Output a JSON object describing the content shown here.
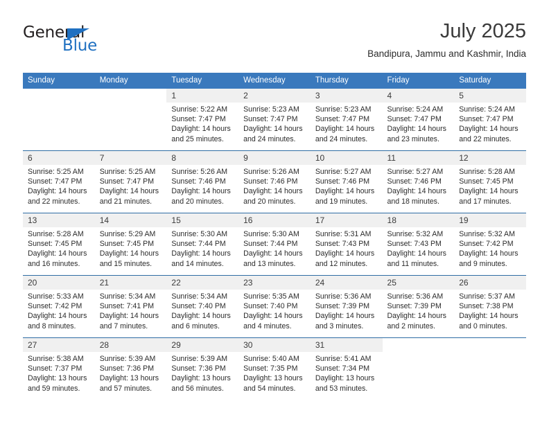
{
  "brand": {
    "name_part1": "General",
    "name_part2": "Blue"
  },
  "header": {
    "title": "July 2025",
    "subtitle": "Bandipura, Jammu and Kashmir, India"
  },
  "colors": {
    "header_blue": "#3a79bd",
    "row_rule_blue": "#2e6da4",
    "daynum_band": "#f0f0f0",
    "brand_blue": "#1f70c1"
  },
  "weekday_headers": [
    "Sunday",
    "Monday",
    "Tuesday",
    "Wednesday",
    "Thursday",
    "Friday",
    "Saturday"
  ],
  "weeks": [
    [
      {
        "day": "",
        "blank": true,
        "shaded": false,
        "sunrise": "",
        "sunset": "",
        "daylight": ""
      },
      {
        "day": "",
        "blank": true,
        "shaded": false,
        "sunrise": "",
        "sunset": "",
        "daylight": ""
      },
      {
        "day": "1",
        "blank": false,
        "shaded": true,
        "sunrise": "Sunrise: 5:22 AM",
        "sunset": "Sunset: 7:47 PM",
        "daylight": "Daylight: 14 hours and 25 minutes."
      },
      {
        "day": "2",
        "blank": false,
        "shaded": true,
        "sunrise": "Sunrise: 5:23 AM",
        "sunset": "Sunset: 7:47 PM",
        "daylight": "Daylight: 14 hours and 24 minutes."
      },
      {
        "day": "3",
        "blank": false,
        "shaded": true,
        "sunrise": "Sunrise: 5:23 AM",
        "sunset": "Sunset: 7:47 PM",
        "daylight": "Daylight: 14 hours and 24 minutes."
      },
      {
        "day": "4",
        "blank": false,
        "shaded": true,
        "sunrise": "Sunrise: 5:24 AM",
        "sunset": "Sunset: 7:47 PM",
        "daylight": "Daylight: 14 hours and 23 minutes."
      },
      {
        "day": "5",
        "blank": false,
        "shaded": true,
        "sunrise": "Sunrise: 5:24 AM",
        "sunset": "Sunset: 7:47 PM",
        "daylight": "Daylight: 14 hours and 22 minutes."
      }
    ],
    [
      {
        "day": "6",
        "blank": false,
        "shaded": true,
        "sunrise": "Sunrise: 5:25 AM",
        "sunset": "Sunset: 7:47 PM",
        "daylight": "Daylight: 14 hours and 22 minutes."
      },
      {
        "day": "7",
        "blank": false,
        "shaded": true,
        "sunrise": "Sunrise: 5:25 AM",
        "sunset": "Sunset: 7:47 PM",
        "daylight": "Daylight: 14 hours and 21 minutes."
      },
      {
        "day": "8",
        "blank": false,
        "shaded": true,
        "sunrise": "Sunrise: 5:26 AM",
        "sunset": "Sunset: 7:46 PM",
        "daylight": "Daylight: 14 hours and 20 minutes."
      },
      {
        "day": "9",
        "blank": false,
        "shaded": true,
        "sunrise": "Sunrise: 5:26 AM",
        "sunset": "Sunset: 7:46 PM",
        "daylight": "Daylight: 14 hours and 20 minutes."
      },
      {
        "day": "10",
        "blank": false,
        "shaded": true,
        "sunrise": "Sunrise: 5:27 AM",
        "sunset": "Sunset: 7:46 PM",
        "daylight": "Daylight: 14 hours and 19 minutes."
      },
      {
        "day": "11",
        "blank": false,
        "shaded": true,
        "sunrise": "Sunrise: 5:27 AM",
        "sunset": "Sunset: 7:46 PM",
        "daylight": "Daylight: 14 hours and 18 minutes."
      },
      {
        "day": "12",
        "blank": false,
        "shaded": true,
        "sunrise": "Sunrise: 5:28 AM",
        "sunset": "Sunset: 7:45 PM",
        "daylight": "Daylight: 14 hours and 17 minutes."
      }
    ],
    [
      {
        "day": "13",
        "blank": false,
        "shaded": true,
        "sunrise": "Sunrise: 5:28 AM",
        "sunset": "Sunset: 7:45 PM",
        "daylight": "Daylight: 14 hours and 16 minutes."
      },
      {
        "day": "14",
        "blank": false,
        "shaded": true,
        "sunrise": "Sunrise: 5:29 AM",
        "sunset": "Sunset: 7:45 PM",
        "daylight": "Daylight: 14 hours and 15 minutes."
      },
      {
        "day": "15",
        "blank": false,
        "shaded": true,
        "sunrise": "Sunrise: 5:30 AM",
        "sunset": "Sunset: 7:44 PM",
        "daylight": "Daylight: 14 hours and 14 minutes."
      },
      {
        "day": "16",
        "blank": false,
        "shaded": true,
        "sunrise": "Sunrise: 5:30 AM",
        "sunset": "Sunset: 7:44 PM",
        "daylight": "Daylight: 14 hours and 13 minutes."
      },
      {
        "day": "17",
        "blank": false,
        "shaded": true,
        "sunrise": "Sunrise: 5:31 AM",
        "sunset": "Sunset: 7:43 PM",
        "daylight": "Daylight: 14 hours and 12 minutes."
      },
      {
        "day": "18",
        "blank": false,
        "shaded": true,
        "sunrise": "Sunrise: 5:32 AM",
        "sunset": "Sunset: 7:43 PM",
        "daylight": "Daylight: 14 hours and 11 minutes."
      },
      {
        "day": "19",
        "blank": false,
        "shaded": true,
        "sunrise": "Sunrise: 5:32 AM",
        "sunset": "Sunset: 7:42 PM",
        "daylight": "Daylight: 14 hours and 9 minutes."
      }
    ],
    [
      {
        "day": "20",
        "blank": false,
        "shaded": true,
        "sunrise": "Sunrise: 5:33 AM",
        "sunset": "Sunset: 7:42 PM",
        "daylight": "Daylight: 14 hours and 8 minutes."
      },
      {
        "day": "21",
        "blank": false,
        "shaded": true,
        "sunrise": "Sunrise: 5:34 AM",
        "sunset": "Sunset: 7:41 PM",
        "daylight": "Daylight: 14 hours and 7 minutes."
      },
      {
        "day": "22",
        "blank": false,
        "shaded": true,
        "sunrise": "Sunrise: 5:34 AM",
        "sunset": "Sunset: 7:40 PM",
        "daylight": "Daylight: 14 hours and 6 minutes."
      },
      {
        "day": "23",
        "blank": false,
        "shaded": true,
        "sunrise": "Sunrise: 5:35 AM",
        "sunset": "Sunset: 7:40 PM",
        "daylight": "Daylight: 14 hours and 4 minutes."
      },
      {
        "day": "24",
        "blank": false,
        "shaded": true,
        "sunrise": "Sunrise: 5:36 AM",
        "sunset": "Sunset: 7:39 PM",
        "daylight": "Daylight: 14 hours and 3 minutes."
      },
      {
        "day": "25",
        "blank": false,
        "shaded": true,
        "sunrise": "Sunrise: 5:36 AM",
        "sunset": "Sunset: 7:39 PM",
        "daylight": "Daylight: 14 hours and 2 minutes."
      },
      {
        "day": "26",
        "blank": false,
        "shaded": true,
        "sunrise": "Sunrise: 5:37 AM",
        "sunset": "Sunset: 7:38 PM",
        "daylight": "Daylight: 14 hours and 0 minutes."
      }
    ],
    [
      {
        "day": "27",
        "blank": false,
        "shaded": true,
        "sunrise": "Sunrise: 5:38 AM",
        "sunset": "Sunset: 7:37 PM",
        "daylight": "Daylight: 13 hours and 59 minutes."
      },
      {
        "day": "28",
        "blank": false,
        "shaded": true,
        "sunrise": "Sunrise: 5:39 AM",
        "sunset": "Sunset: 7:36 PM",
        "daylight": "Daylight: 13 hours and 57 minutes."
      },
      {
        "day": "29",
        "blank": false,
        "shaded": true,
        "sunrise": "Sunrise: 5:39 AM",
        "sunset": "Sunset: 7:36 PM",
        "daylight": "Daylight: 13 hours and 56 minutes."
      },
      {
        "day": "30",
        "blank": false,
        "shaded": true,
        "sunrise": "Sunrise: 5:40 AM",
        "sunset": "Sunset: 7:35 PM",
        "daylight": "Daylight: 13 hours and 54 minutes."
      },
      {
        "day": "31",
        "blank": false,
        "shaded": true,
        "sunrise": "Sunrise: 5:41 AM",
        "sunset": "Sunset: 7:34 PM",
        "daylight": "Daylight: 13 hours and 53 minutes."
      },
      {
        "day": "",
        "blank": true,
        "shaded": false,
        "sunrise": "",
        "sunset": "",
        "daylight": ""
      },
      {
        "day": "",
        "blank": true,
        "shaded": false,
        "sunrise": "",
        "sunset": "",
        "daylight": ""
      }
    ]
  ]
}
